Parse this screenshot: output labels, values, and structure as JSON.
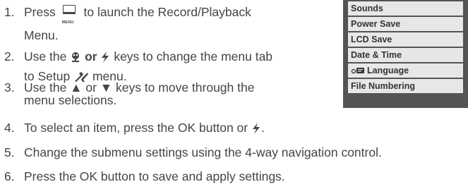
{
  "steps": [
    {
      "num": "1.",
      "parts": [
        "Press",
        "to launch the Record/Playback",
        "Menu."
      ],
      "menu_icon_label": "MENU"
    },
    {
      "num": "2.",
      "parts": [
        "Use the",
        "or",
        "keys to change the menu tab",
        "to Setup",
        "menu."
      ]
    },
    {
      "num": "3.",
      "parts": [
        "Use the ▲ or ▼ keys to move through the",
        "menu selections."
      ]
    },
    {
      "num": "4.",
      "parts": [
        "To select an item, press the OK button or",
        "."
      ]
    },
    {
      "num": "5.",
      "text": "Change the submenu settings using the 4-way navigation control."
    },
    {
      "num": "6.",
      "text": "Press the OK button to save and apply settings."
    }
  ],
  "setup_menu": {
    "items": [
      "Sounds",
      "Power Save",
      "LCD Save",
      "Date & Time",
      "Language",
      "File Numbering"
    ]
  },
  "colors": {
    "text": "#454545",
    "panel_bg": "#545454",
    "item_bg": "#e7e7e7"
  },
  "icons": [
    "menu-button-icon",
    "left-key-icon",
    "right-key-icon",
    "setup-tools-icon",
    "language-icon"
  ]
}
